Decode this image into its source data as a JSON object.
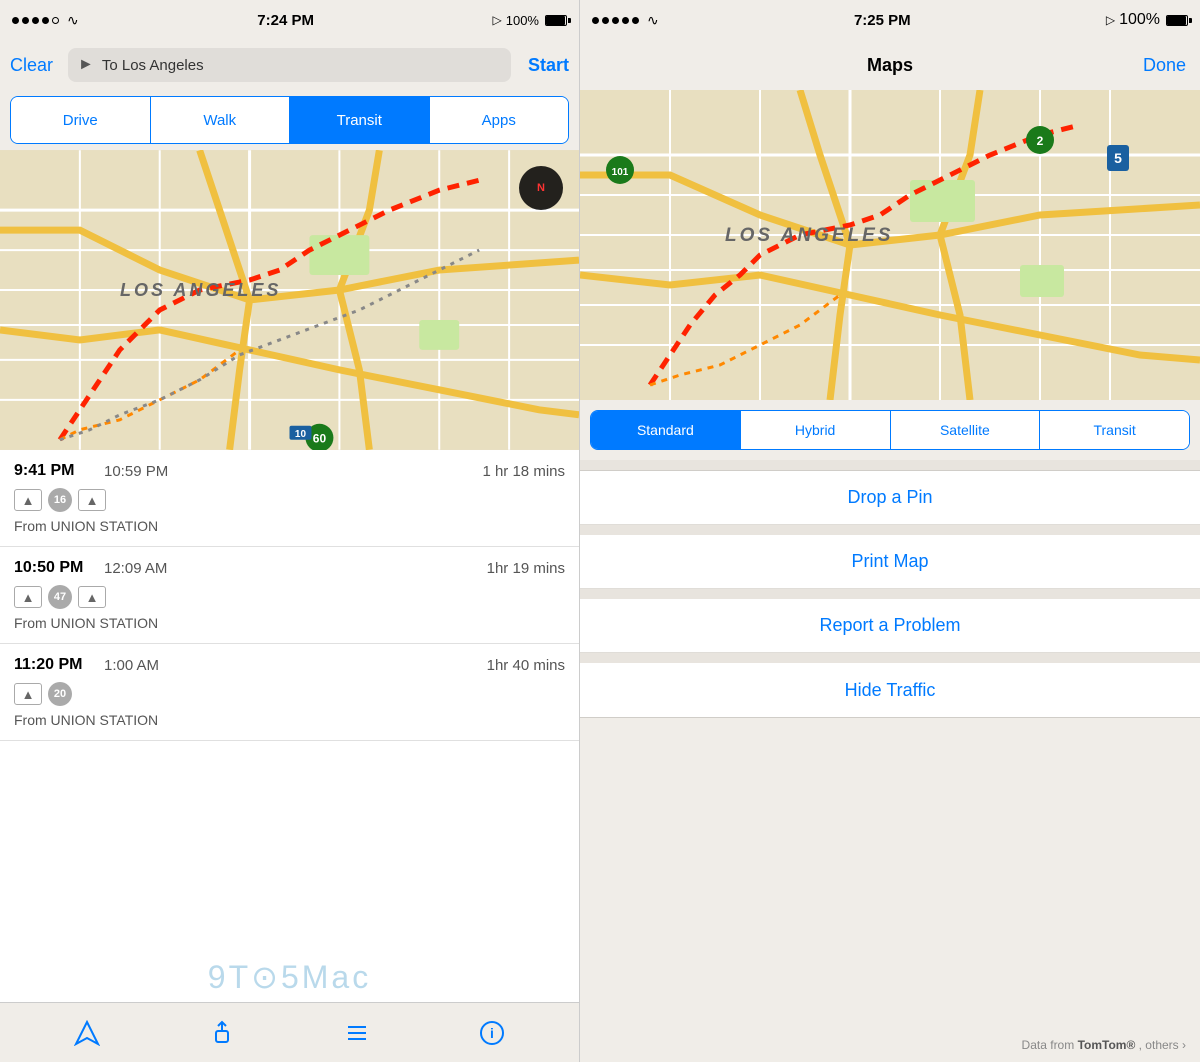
{
  "left": {
    "status": {
      "time": "7:24 PM",
      "signal": "●●●●○",
      "battery": "100%"
    },
    "nav": {
      "clear_label": "Clear",
      "destination": "To Los Angeles",
      "start_label": "Start"
    },
    "tabs": [
      {
        "label": "Drive",
        "active": false
      },
      {
        "label": "Walk",
        "active": false
      },
      {
        "label": "Transit",
        "active": true
      },
      {
        "label": "Apps",
        "active": false
      }
    ],
    "transit_routes": [
      {
        "depart": "9:41 PM",
        "arrive": "10:59 PM",
        "duration": "1 hr 18 mins",
        "buses": [
          "16"
        ],
        "from": "From UNION STATION"
      },
      {
        "depart": "10:50 PM",
        "arrive": "12:09 AM",
        "duration": "1hr 19 mins",
        "buses": [
          "47"
        ],
        "from": "From UNION STATION"
      },
      {
        "depart": "11:20 PM",
        "arrive": "1:00 AM",
        "duration": "1hr 40 mins",
        "buses": [
          "20"
        ],
        "from": "From UNION STATION"
      }
    ],
    "toolbar": {
      "location_label": "⌖",
      "share_label": "↑",
      "list_label": "≡",
      "info_label": "ⓘ"
    }
  },
  "right": {
    "status": {
      "time": "7:25 PM",
      "battery": "100%"
    },
    "nav": {
      "title": "Maps",
      "done_label": "Done"
    },
    "map_types": [
      {
        "label": "Standard",
        "active": true
      },
      {
        "label": "Hybrid",
        "active": false
      },
      {
        "label": "Satellite",
        "active": false
      },
      {
        "label": "Transit",
        "active": false
      }
    ],
    "menu_items": [
      {
        "label": "Drop a Pin"
      },
      {
        "label": "Print Map"
      },
      {
        "label": "Report a Problem"
      },
      {
        "label": "Hide Traffic"
      }
    ],
    "footer": {
      "text": "Data from TomTom®, others ›"
    }
  },
  "watermark": "9TO5Mac"
}
